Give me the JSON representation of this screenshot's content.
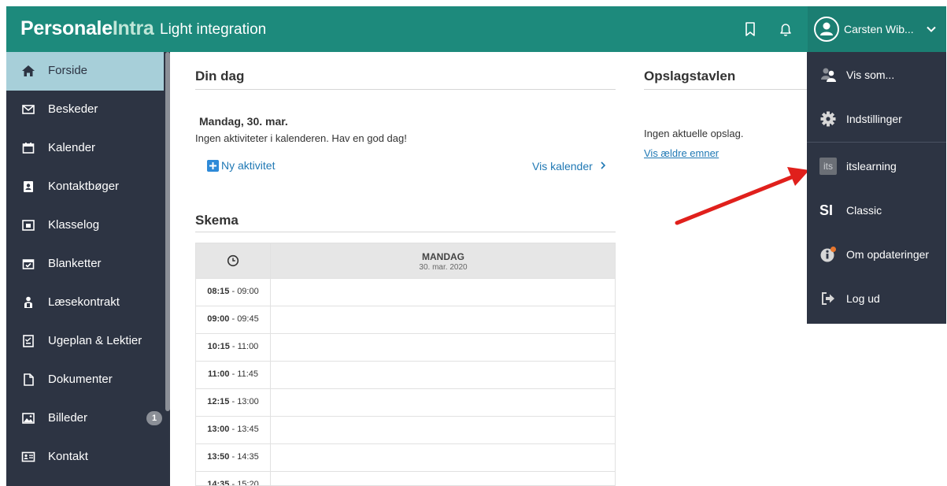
{
  "header": {
    "logo_a": "Personale",
    "logo_b": "Intra",
    "subtitle": "Light integration",
    "user_name": "Carsten Wib...",
    "icons": [
      "bookmark-icon",
      "bell-icon",
      "user-avatar-icon",
      "chevron-down-icon"
    ]
  },
  "sidebar": {
    "items": [
      {
        "label": "Forside",
        "icon": "home-icon"
      },
      {
        "label": "Beskeder",
        "icon": "envelope-icon"
      },
      {
        "label": "Kalender",
        "icon": "calendar-icon"
      },
      {
        "label": "Kontaktbøger",
        "icon": "contact-book-icon"
      },
      {
        "label": "Klasselog",
        "icon": "class-log-icon"
      },
      {
        "label": "Blanketter",
        "icon": "form-calendar-icon"
      },
      {
        "label": "Læsekontrakt",
        "icon": "reader-icon"
      },
      {
        "label": "Ugeplan & Lektier",
        "icon": "checklist-icon"
      },
      {
        "label": "Dokumenter",
        "icon": "document-icon"
      },
      {
        "label": "Billeder",
        "icon": "image-icon",
        "badge": "1"
      },
      {
        "label": "Kontakt",
        "icon": "id-card-icon"
      }
    ]
  },
  "din_dag": {
    "title": "Din dag",
    "date": "Mandag, 30. mar.",
    "message": "Ingen aktiviteter i kalenderen. Hav en god dag!",
    "new_activity": "Ny aktivitet",
    "show_calendar": "Vis kalender"
  },
  "skema": {
    "title": "Skema",
    "day": "MANDAG",
    "day_date": "30. mar. 2020",
    "rows": [
      {
        "start": "08:15",
        "end": "09:00"
      },
      {
        "start": "09:00",
        "end": "09:45"
      },
      {
        "start": "10:15",
        "end": "11:00"
      },
      {
        "start": "11:00",
        "end": "11:45"
      },
      {
        "start": "12:15",
        "end": "13:00"
      },
      {
        "start": "13:00",
        "end": "13:45"
      },
      {
        "start": "13:50",
        "end": "14:35"
      },
      {
        "start": "14:35",
        "end": "15:20"
      }
    ]
  },
  "opslag": {
    "title": "Opslagstavlen",
    "message": "Ingen aktuelle opslag.",
    "older_link": "Vis ældre emner"
  },
  "dropdown": {
    "items": [
      {
        "label": "Vis som...",
        "icon": "users-icon"
      },
      {
        "label": "Indstillinger",
        "icon": "gear-icon"
      },
      {
        "label": "itslearning",
        "icon": "itslearning-icon",
        "icon_text": "its"
      },
      {
        "label": "Classic",
        "icon": "classic-icon",
        "icon_text": "SI"
      },
      {
        "label": "Om opdateringer",
        "icon": "info-update-icon"
      },
      {
        "label": "Log ud",
        "icon": "logout-icon"
      }
    ]
  },
  "colors": {
    "header": "#1d8a7c",
    "sidebar": "#2d3443",
    "active": "#a7cfd9",
    "link": "#1f78b4",
    "arrow": "#e0201c"
  }
}
